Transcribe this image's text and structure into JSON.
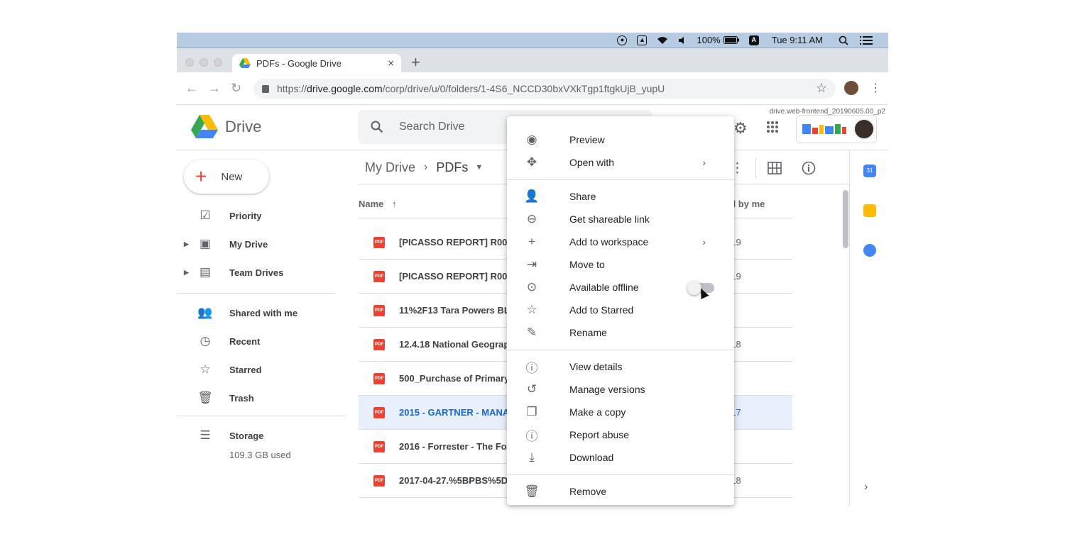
{
  "menubar": {
    "battery": "100%",
    "clock": "Tue 9:11 AM",
    "icons": [
      "record-icon",
      "drive-sync-icon",
      "wifi-icon",
      "volume-icon",
      "battery-icon",
      "input-source-icon",
      "spotlight-icon",
      "list-icon"
    ],
    "input_source": "A"
  },
  "browser": {
    "tab_title": "PDFs - Google Drive",
    "tab_close": "×",
    "new_tab": "+",
    "url_prefix": "https://",
    "url_domain": "drive.google.com",
    "url_path": "/corp/drive/u/0/folders/1-4S6_NCCD30bxVXkTgp1ftgkUjB_yupU"
  },
  "drive": {
    "logo_text": "Drive",
    "search_placeholder": "Search Drive",
    "build_tag": "drive.web-frontend_20190605.00_p2",
    "brand_colors": [
      "#4285f4",
      "#ea4335",
      "#fbbc05",
      "#4285f4",
      "#34a853",
      "#ea4335"
    ]
  },
  "sidebar": {
    "new_label": "New",
    "items": [
      {
        "label": "Priority",
        "icon": "priority-icon"
      },
      {
        "label": "My Drive",
        "icon": "my-drive-icon"
      },
      {
        "label": "Team Drives",
        "icon": "team-drives-icon"
      },
      {
        "label": "Shared with me",
        "icon": "shared-icon"
      },
      {
        "label": "Recent",
        "icon": "clock-icon"
      },
      {
        "label": "Starred",
        "icon": "star-icon"
      },
      {
        "label": "Trash",
        "icon": "trash-icon"
      },
      {
        "label": "Storage",
        "icon": "storage-icon"
      }
    ],
    "storage_used": "109.3 GB used"
  },
  "main": {
    "breadcrumb_root": "My Drive",
    "breadcrumb_current": "PDFs",
    "col_name": "Name",
    "col_owner": "ed by me",
    "files": [
      {
        "name": "[PICASSO REPORT] R001-2",
        "date": "019"
      },
      {
        "name": "[PICASSO REPORT] R002-2",
        "date": "019"
      },
      {
        "name": "11%2F13 Tara Powers BLD",
        "date": ""
      },
      {
        "name": "12.4.18 National Geograph",
        "date": "018"
      },
      {
        "name": "500_Purchase of Primary I",
        "date": ""
      },
      {
        "name": "2015 - GARTNER - MANAG",
        "date": "017"
      },
      {
        "name": "2016 - Forrester - The Forr",
        "date": ""
      },
      {
        "name": "2017-04-27.%5BPBS%5DA",
        "date": "018"
      }
    ],
    "pdf_badge": "PDF"
  },
  "context_menu": {
    "items": [
      {
        "label": "Preview",
        "icon": "eye-icon"
      },
      {
        "label": "Open with",
        "icon": "move-arrows-icon"
      },
      {
        "label": "Share",
        "icon": "add-person-icon"
      },
      {
        "label": "Get shareable link",
        "icon": "link-icon"
      },
      {
        "label": "Add to workspace",
        "icon": "plus-icon"
      },
      {
        "label": "Move to",
        "icon": "folder-move-icon"
      },
      {
        "label": "Available offline",
        "icon": "offline-check-icon"
      },
      {
        "label": "Add to Starred",
        "icon": "star-outline-icon"
      },
      {
        "label": "Rename",
        "icon": "pencil-icon"
      },
      {
        "label": "View details",
        "icon": "info-icon"
      },
      {
        "label": "Manage versions",
        "icon": "history-icon"
      },
      {
        "label": "Make a copy",
        "icon": "copy-icon"
      },
      {
        "label": "Report abuse",
        "icon": "alert-icon"
      },
      {
        "label": "Download",
        "icon": "download-icon"
      },
      {
        "label": "Remove",
        "icon": "trash-icon"
      }
    ],
    "offline_enabled": false
  }
}
